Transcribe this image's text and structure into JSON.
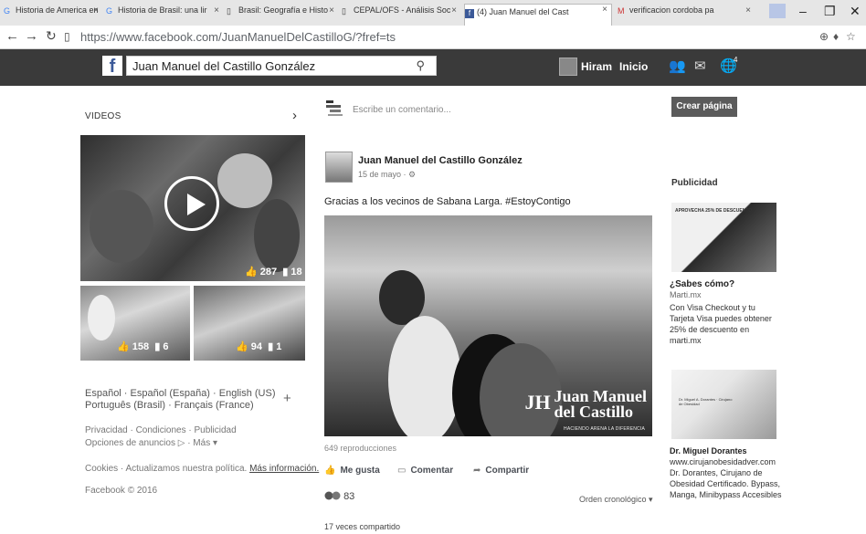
{
  "browser": {
    "tabs": [
      {
        "label": "Historia de America en"
      },
      {
        "label": "Historia de Brasil: una lir"
      },
      {
        "label": "Brasil: Geografía e Histo"
      },
      {
        "label": "CEPAL/OFS - Análisis Soc"
      },
      {
        "label": "(4) Juan Manuel del Cast"
      },
      {
        "label": "verificacion cordoba pa"
      }
    ],
    "url": "https://www.facebook.com/JuanManuelDelCastilloG/?fref=ts",
    "window_controls": {
      "minimize": "–",
      "restore": "❐",
      "close": "✕"
    }
  },
  "fb_header": {
    "logo": "f",
    "search_value": "Juan Manuel del Castillo González",
    "user_name": "Hiram",
    "home_label": "Inicio",
    "notification_count": "4"
  },
  "left_column": {
    "videos_label": "VIDEOS",
    "main_video": {
      "likes": "287",
      "comments": "18"
    },
    "thumb1": {
      "likes": "158",
      "comments": "6"
    },
    "thumb2": {
      "likes": "94",
      "comments": "1"
    },
    "languages_line1": "Español · Español (España) · English (US)",
    "languages_line2": "Português (Brasil) · Français (France)",
    "footer_line1": "Privacidad · Condiciones · Publicidad",
    "footer_line2": "Opciones de anuncios ▷ · Más ▾",
    "footer_line3_prefix": "Cookies · Actualizamos nuestra política. ",
    "footer_line3_link": "Más información.",
    "copyright": "Facebook © 2016"
  },
  "post": {
    "comment_placeholder": "Escribe un comentario...",
    "author": "Juan Manuel del Castillo González",
    "date": "15 de mayo · ⚙",
    "text": "Gracias a los vecinos de Sabana Larga. #EstoyContigo",
    "watermark_initials": "JH",
    "watermark_line1": "Juan Manuel",
    "watermark_line2": "del Castillo",
    "watermark_tag": "HACIENDO ARENA LA DIFERENCIA",
    "views": "649 reproducciones",
    "like_label": "Me gusta",
    "comment_label": "Comentar",
    "share_label": "Compartir",
    "reaction_count": "83",
    "order_label": "Orden cronológico ▾",
    "shares": "17 veces compartido"
  },
  "right_column": {
    "create_page": "Crear página",
    "ads_heading": "Publicidad",
    "ad1": {
      "promo": "APROVECHA 25% DE DESCUENTO",
      "title": "¿Sabes cómo?",
      "site": "Marti.mx",
      "body": "Con Visa Checkout y tu Tarjeta Visa puedes obtener 25% de descuento en marti.mx"
    },
    "ad2": {
      "caption": "Dr. Miguel A. Dorantes · Cirujano de Obesidad",
      "title": "Dr. Miguel Dorantes",
      "body": "www.cirujanobesidadver.com Dr. Dorantes, Cirujano de Obesidad Certificado. Bypass, Manga, Minibypass Accesibles"
    }
  }
}
